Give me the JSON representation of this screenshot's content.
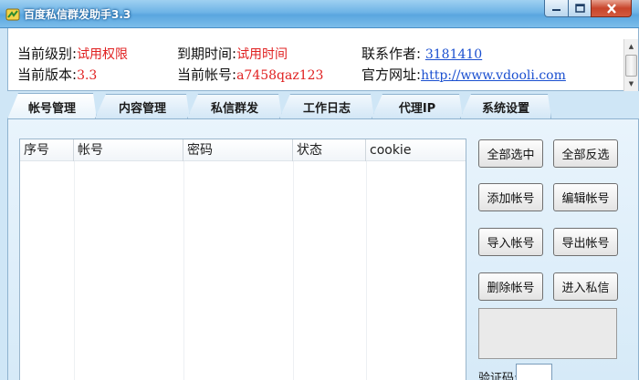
{
  "window": {
    "title": "百度私信群发助手3.3",
    "controls": [
      "minimize",
      "maximize",
      "close"
    ],
    "accent_color": "#5aa6df"
  },
  "info": {
    "level_label": "当前级别:",
    "level_value": "试用权限",
    "expire_label": "到期时间:",
    "expire_value": "试用时间",
    "author_label": "联系作者:",
    "author_value": "3181410",
    "version_label": "当前版本:",
    "version_value": "3.3",
    "account_label": "当前帐号:",
    "account_value": "a7458qaz123",
    "website_label": "官方网址:",
    "website_value": "http://www.vdooli.com"
  },
  "tabs": [
    "帐号管理",
    "内容管理",
    "私信群发",
    "工作日志",
    "代理IP",
    "系统设置"
  ],
  "active_tab": "帐号管理",
  "table": {
    "columns": [
      "序号",
      "帐号",
      "密码",
      "状态",
      "cookie"
    ],
    "rows": []
  },
  "buttons": {
    "select_all": "全部选中",
    "invert_select": "全部反选",
    "add_account": "添加帐号",
    "edit_account": "编辑帐号",
    "import_account": "导入帐号",
    "export_account": "导出帐号",
    "delete_account": "删除帐号",
    "enter_message": "进入私信"
  },
  "captcha": {
    "label": "验证码:",
    "value": ""
  },
  "colors": {
    "value_red": "#e02020",
    "link_blue": "#1a4fd0",
    "panel_bg": "#d6eaf8"
  }
}
